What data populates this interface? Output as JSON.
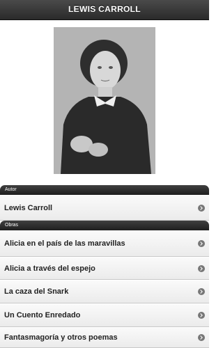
{
  "header": {
    "title": "LEWIS CARROLL"
  },
  "sections": {
    "autor": {
      "label": "Autor",
      "items": [
        "Lewis Carroll"
      ]
    },
    "obras": {
      "label": "Obras",
      "items": [
        "Alicia en el país de las maravillas",
        "Alicia a través del espejo",
        "La caza del Snark",
        "Un Cuento Enredado",
        "Fantasmagoría y otros poemas"
      ]
    }
  },
  "icons": {
    "row_chevron": "chevron-right-circle-icon"
  },
  "colors": {
    "header_bg": "#333333",
    "section_bar_bg": "#2a2a2a",
    "row_bg": "#f2f2f2",
    "chevron": "#777777"
  }
}
